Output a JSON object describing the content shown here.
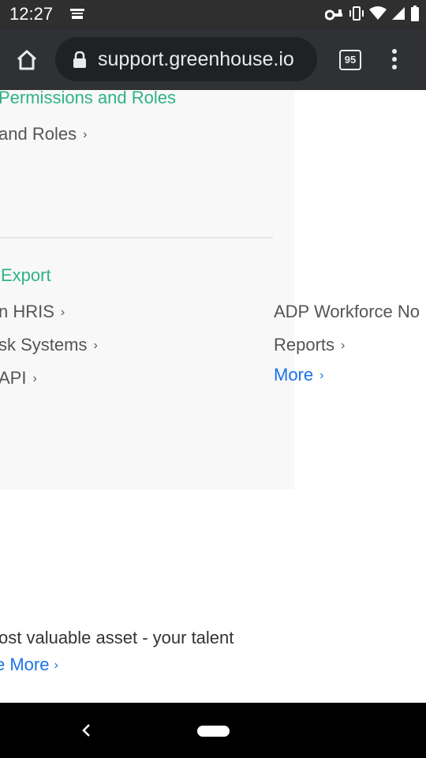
{
  "status_bar": {
    "time": "12:27",
    "icons": [
      "amazon-notification-icon",
      "vpn-key-icon",
      "vibrate-icon",
      "wifi-icon",
      "signal-icon",
      "battery-icon"
    ]
  },
  "browser": {
    "url_display": "support.greenhouse.io",
    "url_visible": "ɔport.greenhouse.io",
    "tab_count": "95",
    "icons": [
      "home-icon",
      "lock-icon",
      "tab-switcher-icon",
      "overflow-menu-icon"
    ]
  },
  "page": {
    "sections": {
      "permissions": {
        "title": "Permissions and Roles",
        "links": [
          "and Roles"
        ]
      },
      "export": {
        "title": "Export",
        "left_links": [
          "n HRIS",
          "sk Systems",
          "API"
        ],
        "right_links": [
          "ADP Workforce No",
          "Reports"
        ],
        "more_label": "More"
      }
    },
    "tagline": "ost valuable asset - your talent",
    "learn_more": "e More"
  },
  "colors": {
    "section_title": "#2fb286",
    "link_text": "#555555",
    "more_link": "#1a73e8",
    "panel_bg": "#f8f8f8",
    "toolbar_bg": "#303134"
  },
  "nav_bar": {
    "icons": [
      "back-icon",
      "home-pill-icon"
    ]
  }
}
